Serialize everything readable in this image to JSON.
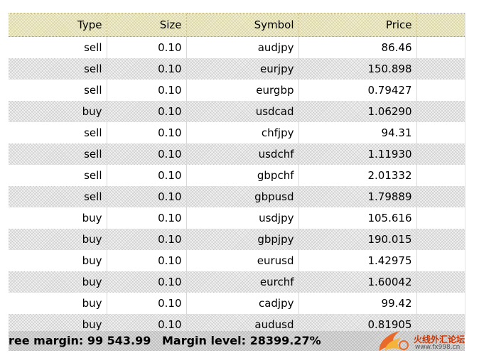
{
  "columns": [
    "Type",
    "Size",
    "Symbol",
    "Price"
  ],
  "rows": [
    {
      "type": "sell",
      "size": "0.10",
      "symbol": "audjpy",
      "price": "86.46"
    },
    {
      "type": "sell",
      "size": "0.10",
      "symbol": "eurjpy",
      "price": "150.898"
    },
    {
      "type": "sell",
      "size": "0.10",
      "symbol": "eurgbp",
      "price": "0.79427"
    },
    {
      "type": "buy",
      "size": "0.10",
      "symbol": "usdcad",
      "price": "1.06290"
    },
    {
      "type": "sell",
      "size": "0.10",
      "symbol": "chfjpy",
      "price": "94.31"
    },
    {
      "type": "sell",
      "size": "0.10",
      "symbol": "usdchf",
      "price": "1.11930"
    },
    {
      "type": "sell",
      "size": "0.10",
      "symbol": "gbpchf",
      "price": "2.01332"
    },
    {
      "type": "sell",
      "size": "0.10",
      "symbol": "gbpusd",
      "price": "1.79889"
    },
    {
      "type": "buy",
      "size": "0.10",
      "symbol": "usdjpy",
      "price": "105.616"
    },
    {
      "type": "buy",
      "size": "0.10",
      "symbol": "gbpjpy",
      "price": "190.015"
    },
    {
      "type": "buy",
      "size": "0.10",
      "symbol": "eurusd",
      "price": "1.42975"
    },
    {
      "type": "buy",
      "size": "0.10",
      "symbol": "eurchf",
      "price": "1.60042"
    },
    {
      "type": "buy",
      "size": "0.10",
      "symbol": "cadjpy",
      "price": "99.42"
    },
    {
      "type": "buy",
      "size": "0.10",
      "symbol": "audusd",
      "price": "0.81905"
    }
  ],
  "status": {
    "free_margin": "ree margin: 99 543.99",
    "margin_level": "Margin level: 28399.27%"
  },
  "logo": {
    "icon": "flame-logo",
    "brand": "火线外汇论坛",
    "url": "www.fx998.cn",
    "colors": {
      "flame_outer": "#e8692a",
      "flame_inner": "#f6b33a"
    }
  },
  "colors": {
    "header_bg": "#f1efcf",
    "alt_row_bg": "#f2f2f2",
    "status_bg": "#dcdcdc"
  }
}
